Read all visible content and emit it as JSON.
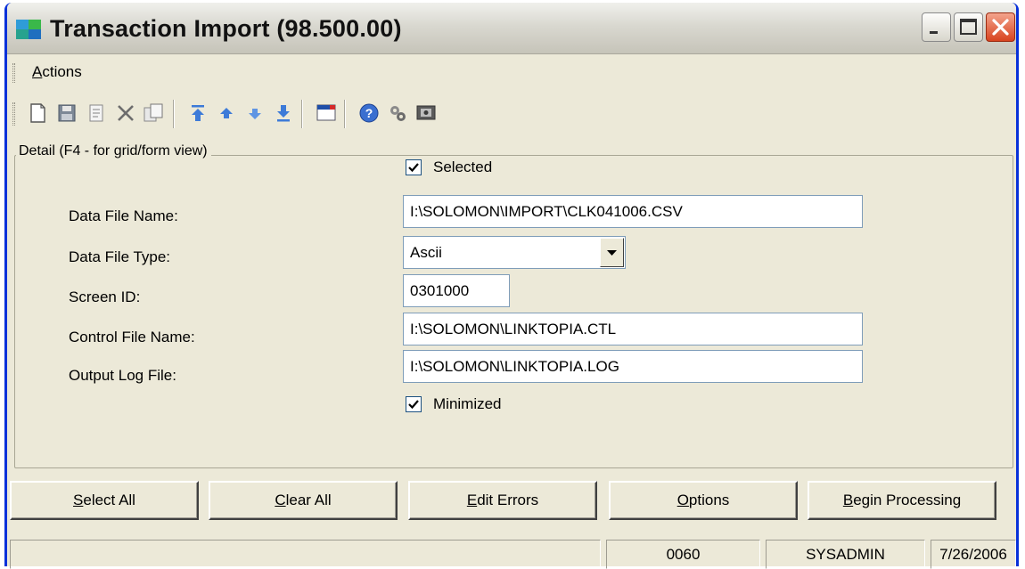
{
  "window": {
    "title": "Transaction Import (98.500.00)",
    "icon": "app-globe-icon",
    "controls": [
      "minimize-icon",
      "maximize-icon",
      "close-icon"
    ]
  },
  "menu": {
    "actions_prefix": "A",
    "actions_rest": "ctions"
  },
  "toolbar": {
    "icons": [
      "new-icon",
      "save-icon",
      "copy-icon",
      "delete-icon",
      "paste-icon",
      "first-icon",
      "previous-icon",
      "next-icon",
      "last-icon",
      "notes-icon",
      "help-icon",
      "customize-icon",
      "screen-icon"
    ]
  },
  "detail": {
    "legend": "Detail (F4 - for grid/form view)",
    "selected_label": "Selected",
    "selected_checked": true,
    "data_file_name_label": "Data File Name:",
    "data_file_name_value": "I:\\SOLOMON\\IMPORT\\CLK041006.CSV",
    "data_file_type_label": "Data File Type:",
    "data_file_type_value": "Ascii",
    "screen_id_label": "Screen ID:",
    "screen_id_value": "0301000",
    "control_file_name_label": "Control File Name:",
    "control_file_name_value": "I:\\SOLOMON\\LINKTOPIA.CTL",
    "output_log_file_label": "Output Log File:",
    "output_log_file_value": "I:\\SOLOMON\\LINKTOPIA.LOG",
    "minimized_label": "Minimized",
    "minimized_checked": true
  },
  "buttons": {
    "select_all_u": "S",
    "select_all_rest": "elect All",
    "clear_all_u": "C",
    "clear_all_rest": "lear All",
    "edit_errors_u": "E",
    "edit_errors_rest": "dit Errors",
    "options_u": "O",
    "options_rest": "ptions",
    "begin_processing_u": "B",
    "begin_processing_rest": "egin Processing"
  },
  "status": {
    "message": "",
    "company": "0060",
    "user": "SYSADMIN",
    "date": "7/26/2006"
  }
}
